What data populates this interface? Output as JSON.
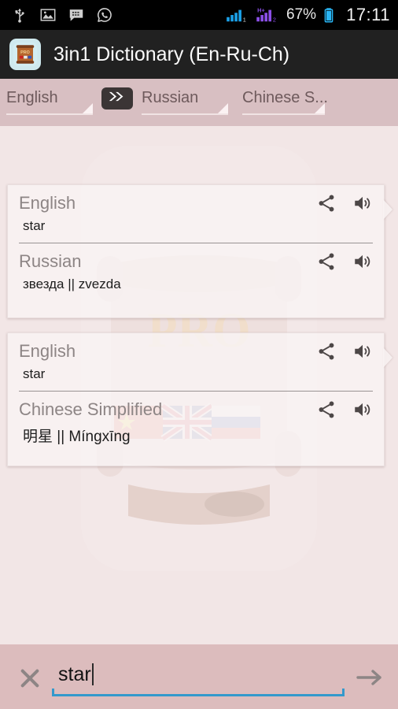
{
  "statusbar": {
    "icons": [
      "usb-icon",
      "gallery-icon",
      "bbm-icon",
      "whatsapp-icon"
    ],
    "signal1": "signal-bars-sim1-icon",
    "signal2": "signal-bars-sim2-icon",
    "network_type": "H+",
    "sim1_label": "1",
    "sim2_label": "2",
    "battery_percent": "67%",
    "battery_icon": "battery-icon",
    "clock": "17:11",
    "bg_color": "#000000",
    "text_color": "#e8e8e8",
    "signal1_color": "#1aa0e8",
    "signal2_color": "#8b4fe8",
    "battery_color": "#29b6f6"
  },
  "titlebar": {
    "app_icon": "scroll-book-app-icon",
    "app_icon_badge": "PRO",
    "title": "3in1 Dictionary (En-Ru-Ch)",
    "bg_color": "#212121",
    "text_color": "#fafafa"
  },
  "langbar": {
    "source_language": "English",
    "target_language_1": "Russian",
    "target_language_2": "Chinese S...",
    "swap_icon": "double-chevron-right-icon",
    "bg_color": "#d8bfc2",
    "text_color": "#6e5a5c"
  },
  "content": {
    "watermark": "scroll-pro-flags-watermark",
    "bg_color": "#f2e6e6",
    "cards": [
      {
        "rows": [
          {
            "language": "English",
            "word": "star",
            "share_icon": "share-icon",
            "speaker_icon": "speaker-icon"
          },
          {
            "language": "Russian",
            "word": "звезда || zvezda",
            "share_icon": "share-icon",
            "speaker_icon": "speaker-icon"
          }
        ]
      },
      {
        "rows": [
          {
            "language": "English",
            "word": "star",
            "share_icon": "share-icon",
            "speaker_icon": "speaker-icon"
          },
          {
            "language": "Chinese Simplified",
            "word": "明星 || Míngxīng",
            "share_icon": "share-icon",
            "speaker_icon": "speaker-icon"
          }
        ]
      }
    ]
  },
  "searchbar": {
    "clear_icon": "close-x-icon",
    "query_value": "star",
    "placeholder": "",
    "go_icon": "arrow-right-icon",
    "bg_color": "#dcbcbd",
    "underline_color": "#3399cc"
  }
}
